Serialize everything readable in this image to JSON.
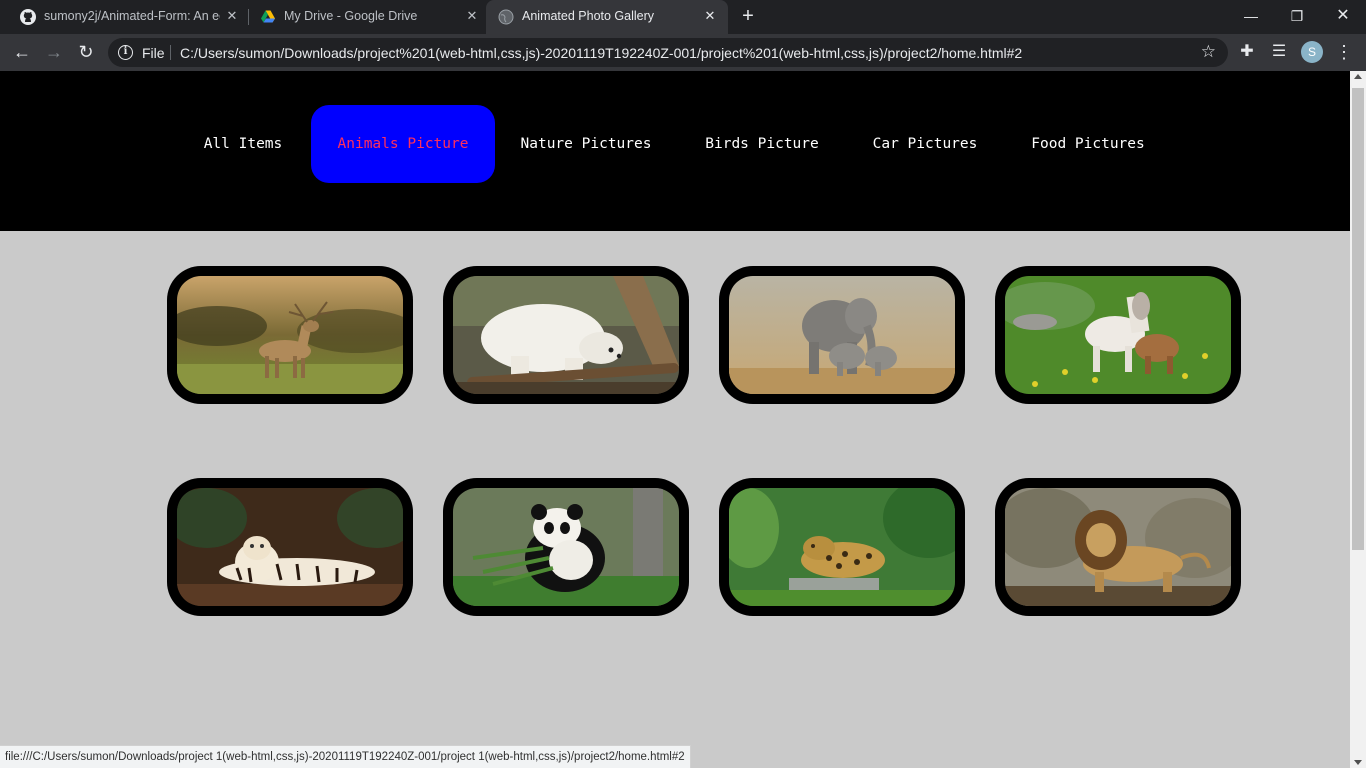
{
  "browser": {
    "tabs": [
      {
        "title": "sumony2j/Animated-Form: An ec",
        "icon": "github-icon"
      },
      {
        "title": "My Drive - Google Drive",
        "icon": "google-drive-icon"
      },
      {
        "title": "Animated Photo Gallery",
        "icon": "globe-icon",
        "active": true
      }
    ],
    "new_tab_label": "+",
    "scheme_label": "File",
    "url": "C:/Users/sumon/Downloads/project%201(web-html,css,js)-20201119T192240Z-001/project%201(web-html,css,js)/project2/home.html#2",
    "profile_initial": "S",
    "status_url": "file:///C:/Users/sumon/Downloads/project 1(web-html,css,js)-20201119T192240Z-001/project 1(web-html,css,js)/project2/home.html#2"
  },
  "gallery": {
    "nav": [
      {
        "label": "All Items",
        "active": false
      },
      {
        "label": "Animals Picture",
        "active": true
      },
      {
        "label": "Nature Pictures",
        "active": false
      },
      {
        "label": "Birds Picture",
        "active": false
      },
      {
        "label": "Car Pictures",
        "active": false
      },
      {
        "label": "Food Pictures",
        "active": false
      }
    ],
    "photos": [
      "deer",
      "polar-bear",
      "elephants",
      "ponies",
      "tiger",
      "panda",
      "leopard",
      "lion"
    ],
    "colors": {
      "active_bg": "#0000ff",
      "active_text": "#ff2f5c",
      "nav_bg": "#000000",
      "page_bg": "#cacaca"
    }
  }
}
